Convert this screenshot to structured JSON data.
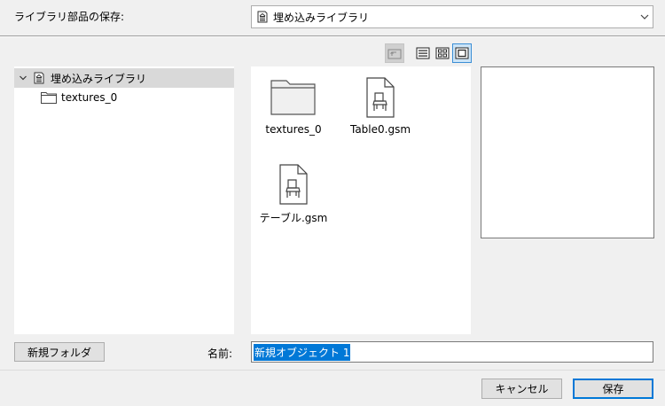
{
  "header": {
    "label": "ライブラリ部品の保存:",
    "location": "埋め込みライブラリ"
  },
  "tree": {
    "root": {
      "label": "埋め込みライブラリ",
      "expanded": true
    },
    "children": [
      {
        "label": "textures_0"
      }
    ]
  },
  "files": [
    {
      "label": "textures_0",
      "icon": "folder-icon"
    },
    {
      "label": "Table0.gsm",
      "icon": "chair-file-icon"
    },
    {
      "label": "テーブル.gsm",
      "icon": "chair-file-icon"
    }
  ],
  "footer": {
    "new_folder_label": "新規フォルダ",
    "name_label": "名前:",
    "name_value": "新規オブジェクト 1",
    "cancel_label": "キャンセル",
    "save_label": "保存"
  },
  "colors": {
    "accent": "#0078d7",
    "selection_bg": "#d9d9d9"
  }
}
